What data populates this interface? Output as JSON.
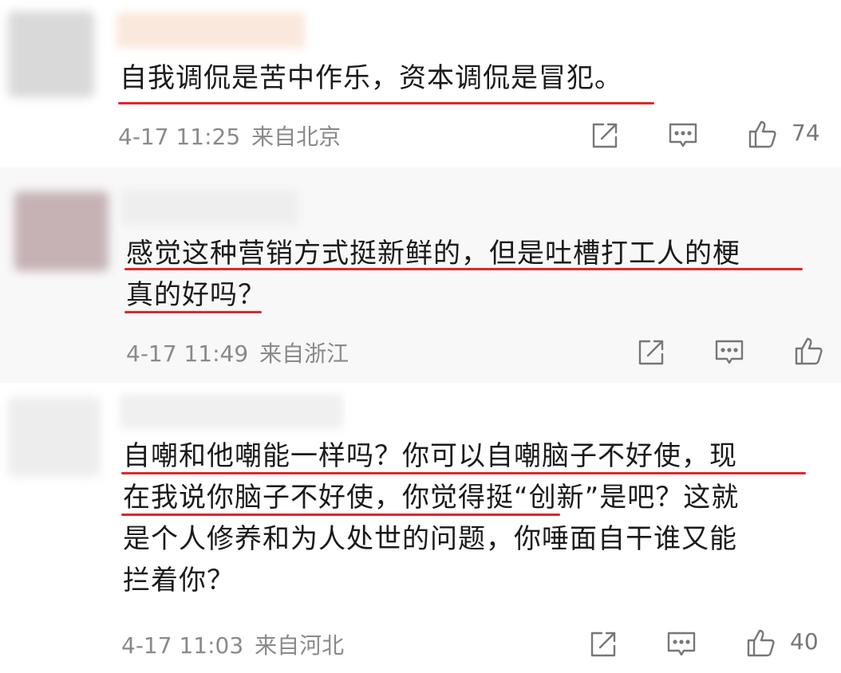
{
  "comments": [
    {
      "lines": [
        "自我调侃是苦中作乐，资本调侃是冒犯。"
      ],
      "date": "4-17 11:25",
      "location": "来自北京",
      "likes": "74"
    },
    {
      "lines": [
        "感觉这种营销方式挺新鲜的，但是吐槽打工人的梗",
        "真的好吗？"
      ],
      "date": "4-17 11:49",
      "location": "来自浙江",
      "likes": ""
    },
    {
      "lines": [
        "自嘲和他嘲能一样吗？你可以自嘲脑子不好使，现",
        "在我说你脑子不好使，你觉得挺“创新”是吧？这就",
        "是个人修养和为人处世的问题，你唾面自干谁又能",
        "拦着你？"
      ],
      "date": "4-17 11:03",
      "location": "来自河北",
      "likes": "40"
    }
  ],
  "icons": [
    "share-icon",
    "comment-icon",
    "like-icon"
  ],
  "colors": {
    "underline": "#e0262a",
    "meta": "#8a8a8a"
  }
}
